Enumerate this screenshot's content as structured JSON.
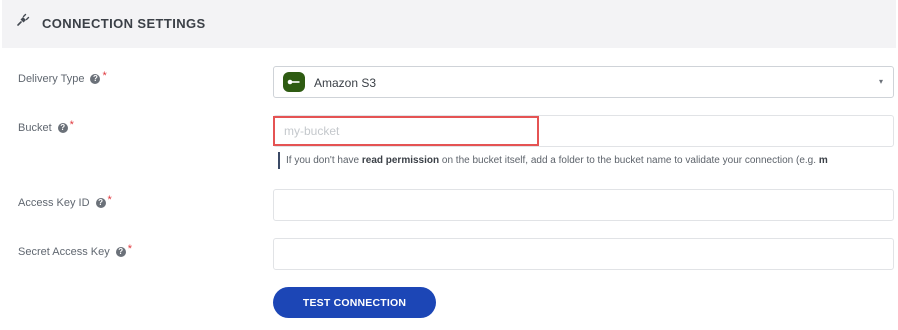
{
  "header": {
    "title": "CONNECTION SETTINGS",
    "icon": "plug-icon"
  },
  "form": {
    "delivery_type": {
      "label": "Delivery Type",
      "help": "?",
      "required_mark": "*",
      "selected": "Amazon S3",
      "badge_color": "#2e5b12",
      "caret": "▾"
    },
    "bucket": {
      "label": "Bucket",
      "help": "?",
      "required_mark": "*",
      "placeholder": "my-bucket",
      "value": "",
      "hint_prefix": "If you don't have ",
      "hint_bold": "read permission",
      "hint_suffix": " on the bucket itself, add a folder to the bucket name to validate your connection (e.g. ",
      "hint_trailing_bold": "m"
    },
    "access_key_id": {
      "label": "Access Key ID",
      "help": "?",
      "required_mark": "*",
      "value": ""
    },
    "secret_access_key": {
      "label": "Secret Access Key",
      "help": "?",
      "required_mark": "*",
      "value": ""
    }
  },
  "actions": {
    "test_connection_label": "TEST CONNECTION",
    "button_color": "#1c46b6"
  },
  "colors": {
    "required": "#e0393e",
    "highlight": "#e55353"
  }
}
